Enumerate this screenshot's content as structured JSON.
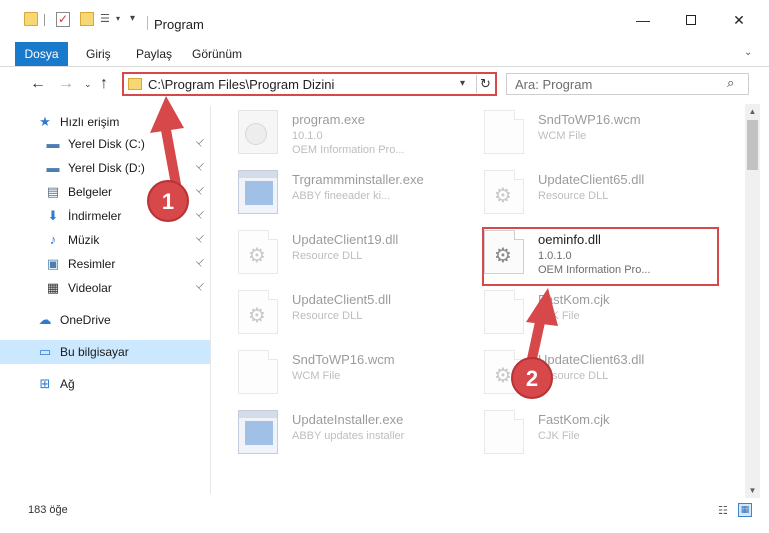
{
  "window": {
    "title": "Program",
    "min_glyph": "—",
    "close_glyph": "✕"
  },
  "quick_access_icons": [
    "folder-icon",
    "properties-checkbox-icon",
    "new-folder-icon",
    "properties-icon",
    "customize-dropdown-icon"
  ],
  "ribbon": {
    "tabs": [
      "Dosya",
      "Giriş",
      "Paylaş",
      "Görünüm"
    ],
    "expand_glyph": "⌄"
  },
  "navigation": {
    "back_glyph": "←",
    "forward_glyph": "→",
    "recent_glyph": "⌄",
    "up_glyph": "↑",
    "address": "C:\\Program Files\\Program Dizini",
    "refresh_glyph": "↻",
    "search_placeholder": "Ara: Program",
    "search_glyph": "⌕"
  },
  "sidebar": {
    "items": [
      {
        "label": "Hızlı erişim",
        "icon": "star-icon",
        "glyph": "★",
        "pinned": false
      },
      {
        "label": "Yerel Disk (C:)",
        "icon": "drive-icon",
        "glyph": "▬",
        "pinned": true
      },
      {
        "label": "Yerel Disk (D:)",
        "icon": "drive-icon",
        "glyph": "▬",
        "pinned": true
      },
      {
        "label": "Belgeler",
        "icon": "documents-icon",
        "glyph": "▤",
        "pinned": true
      },
      {
        "label": "İndirmeler",
        "icon": "download-icon",
        "glyph": "⬇",
        "pinned": true
      },
      {
        "label": "Müzik",
        "icon": "music-icon",
        "glyph": "♪",
        "pinned": true
      },
      {
        "label": "Resimler",
        "icon": "pictures-icon",
        "glyph": "▣",
        "pinned": true
      },
      {
        "label": "Videolar",
        "icon": "videos-icon",
        "glyph": "▦",
        "pinned": true
      },
      {
        "label": "OneDrive",
        "icon": "cloud-icon",
        "glyph": "☁",
        "pinned": false
      },
      {
        "label": "Bu bilgisayar",
        "icon": "computer-icon",
        "glyph": "▭",
        "pinned": false,
        "selected": true
      },
      {
        "label": "Ağ",
        "icon": "network-icon",
        "glyph": "⊞",
        "pinned": false
      }
    ],
    "pin_glyph": "📌"
  },
  "files": [
    {
      "name": "program.exe",
      "meta1": "10.1.0",
      "meta2": "OEM Information Pro...",
      "thumb": "exe"
    },
    {
      "name": "SndToWP16.wcm",
      "meta1": "WCM File",
      "meta2": "",
      "thumb": "doc"
    },
    {
      "name": "Trgrammminstaller.exe",
      "meta1": "ABBY fineeader ki...",
      "meta2": "",
      "thumb": "win"
    },
    {
      "name": "UpdateClient65.dll",
      "meta1": "Resource DLL",
      "meta2": "",
      "thumb": "gear"
    },
    {
      "name": "UpdateClient19.dll",
      "meta1": "Resource DLL",
      "meta2": "",
      "thumb": "gear"
    },
    {
      "name": "oeminfo.dll",
      "meta1": "1.0.1.0",
      "meta2": "OEM Information Pro...",
      "thumb": "gear",
      "highlighted": true
    },
    {
      "name": "UpdateClient5.dll",
      "meta1": "Resource DLL",
      "meta2": "",
      "thumb": "gear"
    },
    {
      "name": "FastKom.cjk",
      "meta1": "CJK File",
      "meta2": "",
      "thumb": "doc"
    },
    {
      "name": "SndToWP16.wcm",
      "meta1": "WCM File",
      "meta2": "",
      "thumb": "doc"
    },
    {
      "name": "UpdateClient63.dll",
      "meta1": "Resource DLL",
      "meta2": "",
      "thumb": "gear"
    },
    {
      "name": "UpdateInstaller.exe",
      "meta1": "ABBY updates installer",
      "meta2": "",
      "thumb": "win"
    },
    {
      "name": "FastKom.cjk",
      "meta1": "CJK File",
      "meta2": "",
      "thumb": "doc"
    }
  ],
  "status": {
    "item_count": "183 öğe"
  },
  "annotations": {
    "step1": "1",
    "step2": "2",
    "color": "#d7484a"
  }
}
